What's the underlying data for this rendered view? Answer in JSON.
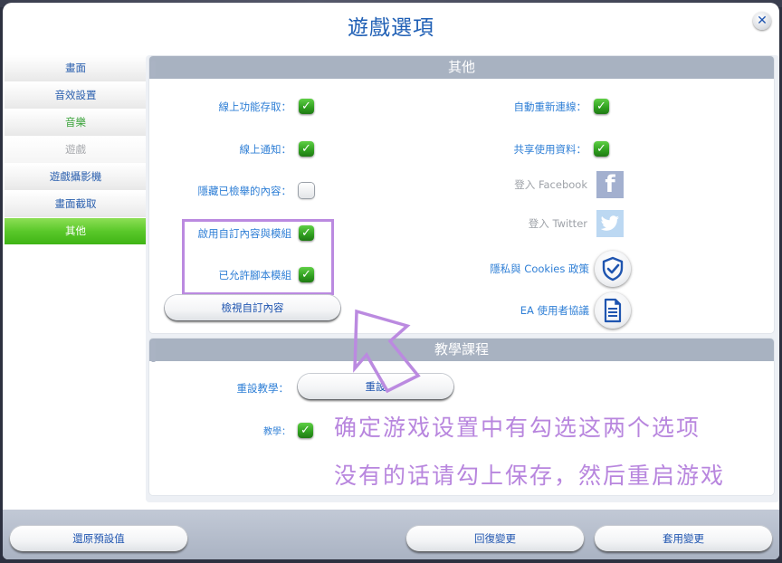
{
  "dialog": {
    "title": "遊戲選項",
    "close_icon": "close-icon"
  },
  "sidebar": {
    "items": [
      {
        "label": "畫面",
        "state": "normal"
      },
      {
        "label": "音效設置",
        "state": "normal"
      },
      {
        "label": "音樂",
        "state": "normal-green"
      },
      {
        "label": "遊戲",
        "state": "disabled"
      },
      {
        "label": "遊戲攝影機",
        "state": "normal"
      },
      {
        "label": "畫面截取",
        "state": "normal"
      },
      {
        "label": "其他",
        "state": "active"
      }
    ]
  },
  "other_section": {
    "header": "其他",
    "left": [
      {
        "label": "線上功能存取：",
        "checked": true
      },
      {
        "label": "線上通知：",
        "checked": true
      },
      {
        "label": "隱藏已檢舉的內容：",
        "checked": false
      },
      {
        "label": "啟用自訂內容與模組",
        "checked": true
      },
      {
        "label": "已允許腳本模組",
        "checked": true
      }
    ],
    "right": [
      {
        "label": "自動重新連線：",
        "checked": true
      },
      {
        "label": "共享使用資料：",
        "checked": true
      }
    ],
    "facebook_label": "登入 Facebook",
    "twitter_label": "登入 Twitter",
    "privacy_label": "隱私與 Cookies 政策",
    "eula_label": "EA 使用者協議",
    "view_custom_content_button": "檢視自訂內容",
    "icons": {
      "facebook": "facebook-icon",
      "twitter": "twitter-icon",
      "privacy": "shield-check-icon",
      "eula": "document-icon"
    }
  },
  "tutorial_section": {
    "header": "教學課程",
    "reset_label": "重設教學：",
    "reset_button": "重設",
    "tutorial_label": "教學：",
    "tutorial_checked": true
  },
  "annotation": {
    "line1": "确定游戏设置中有勾选这两个选项",
    "line2": "没有的话请勾上保存，然后重启游戏",
    "color": "#bb8ae0"
  },
  "footer": {
    "restore_defaults": "還原預設值",
    "revert_changes": "回復變更",
    "apply_changes": "套用變更"
  },
  "colors": {
    "accent_blue": "#1f5fb5",
    "active_green": "#5ac82a",
    "checkbox_green": "#2f9e1f",
    "header_gray": "#a8b2c1"
  }
}
